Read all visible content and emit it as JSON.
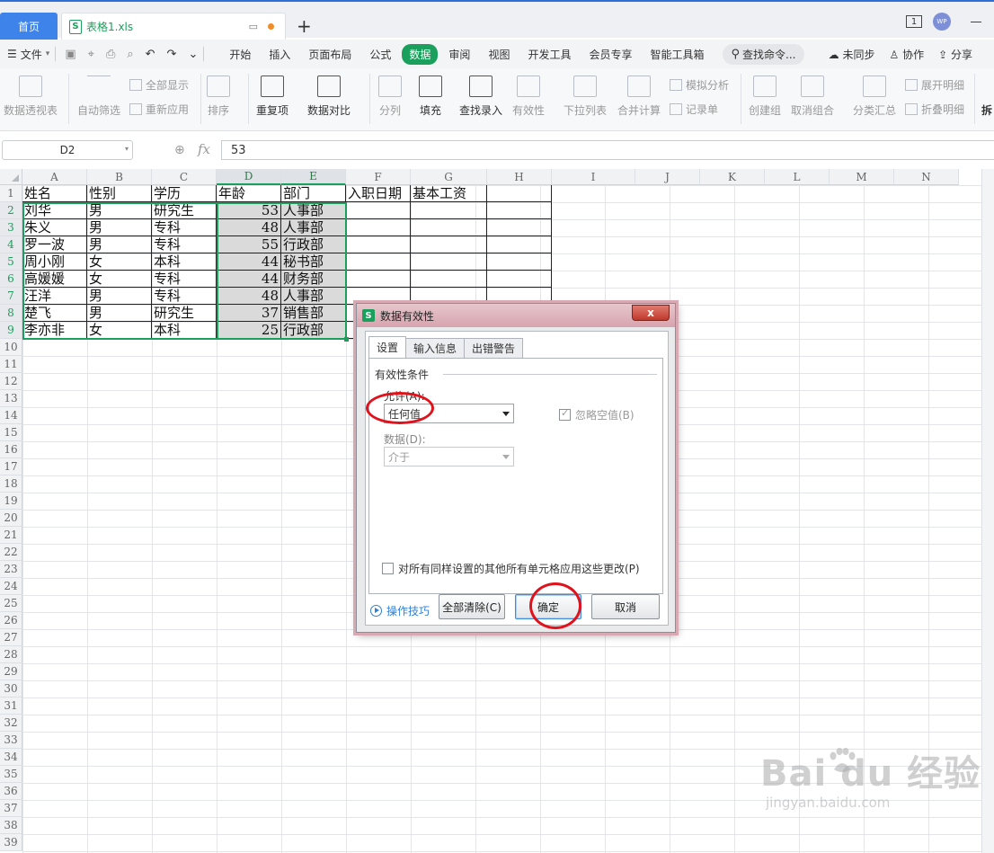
{
  "tabs": {
    "home": "首页",
    "file": "表格1.xls",
    "add": "+"
  },
  "window": {
    "badge": "1",
    "avatar": "WP"
  },
  "menu": {
    "file": "文件",
    "tabs": [
      "开始",
      "插入",
      "页面布局",
      "公式",
      "数据",
      "审阅",
      "视图",
      "开发工具",
      "会员专享",
      "智能工具箱"
    ],
    "active_tab": "数据",
    "search": "查找命令...",
    "right": [
      "未同步",
      "协作",
      "分享"
    ]
  },
  "ribbon": {
    "pivot": "数据透视表",
    "autofilter": "自动筛选",
    "showall": "全部显示",
    "reapply": "重新应用",
    "sort": "排序",
    "duplicates": "重复项",
    "compare": "数据对比",
    "split": "分列",
    "fill": "填充",
    "lookup": "查找录入",
    "validity": "有效性",
    "dropdown": "下拉列表",
    "consolidate": "合并计算",
    "simulate": "模拟分析",
    "record": "记录单",
    "group": "创建组",
    "ungroup": "取消组合",
    "subtotal": "分类汇总",
    "expand": "展开明细",
    "collapse": "折叠明细",
    "more": "拆"
  },
  "formula": {
    "namebox": "D2",
    "fx": "fx",
    "value": "53"
  },
  "columns": [
    "A",
    "B",
    "C",
    "D",
    "E",
    "F",
    "G",
    "H",
    "I",
    "J",
    "K",
    "L",
    "M",
    "N"
  ],
  "rows": [
    "1",
    "2",
    "3",
    "4",
    "5",
    "6",
    "7",
    "8",
    "9",
    "10",
    "11",
    "12",
    "13",
    "14",
    "15",
    "16",
    "17",
    "18",
    "19",
    "20",
    "21",
    "22",
    "23",
    "24",
    "25",
    "26",
    "27",
    "28",
    "29",
    "30",
    "31",
    "32",
    "33",
    "34",
    "35",
    "36",
    "37",
    "38",
    "39"
  ],
  "sheet": {
    "header": [
      "姓名",
      "性别",
      "学历",
      "年龄",
      "部门",
      "入职日期",
      "基本工资"
    ],
    "rows": [
      [
        "刘华",
        "男",
        "研究生",
        "53",
        "人事部"
      ],
      [
        "朱义",
        "男",
        "专科",
        "48",
        "人事部"
      ],
      [
        "罗一波",
        "男",
        "专科",
        "55",
        "行政部"
      ],
      [
        "周小刚",
        "女",
        "本科",
        "44",
        "秘书部"
      ],
      [
        "高媛媛",
        "女",
        "专科",
        "44",
        "财务部"
      ],
      [
        "汪洋",
        "男",
        "专科",
        "48",
        "人事部"
      ],
      [
        "楚飞",
        "男",
        "研究生",
        "37",
        "销售部"
      ],
      [
        "李亦非",
        "女",
        "本科",
        "25",
        "行政部"
      ]
    ]
  },
  "dialog": {
    "title": "数据有效性",
    "close": "x",
    "tabs": [
      "设置",
      "输入信息",
      "出错警告"
    ],
    "group": "有效性条件",
    "allow_label": "允许(A):",
    "allow_value": "任何值",
    "ignore_blank": "忽略空值(B)",
    "data_label": "数据(D):",
    "data_value": "介于",
    "apply_all": "对所有同样设置的其他所有单元格应用这些更改(P)",
    "tips": "操作技巧",
    "clear_all": "全部清除(C)",
    "ok": "确定",
    "cancel": "取消"
  },
  "watermark": {
    "brand": "Bai du 经验",
    "url": "jingyan.baidu.com"
  },
  "colors": {
    "accent": "#1aa05c",
    "tab_blue": "#3e83ea",
    "annotation": "#e0121b"
  }
}
